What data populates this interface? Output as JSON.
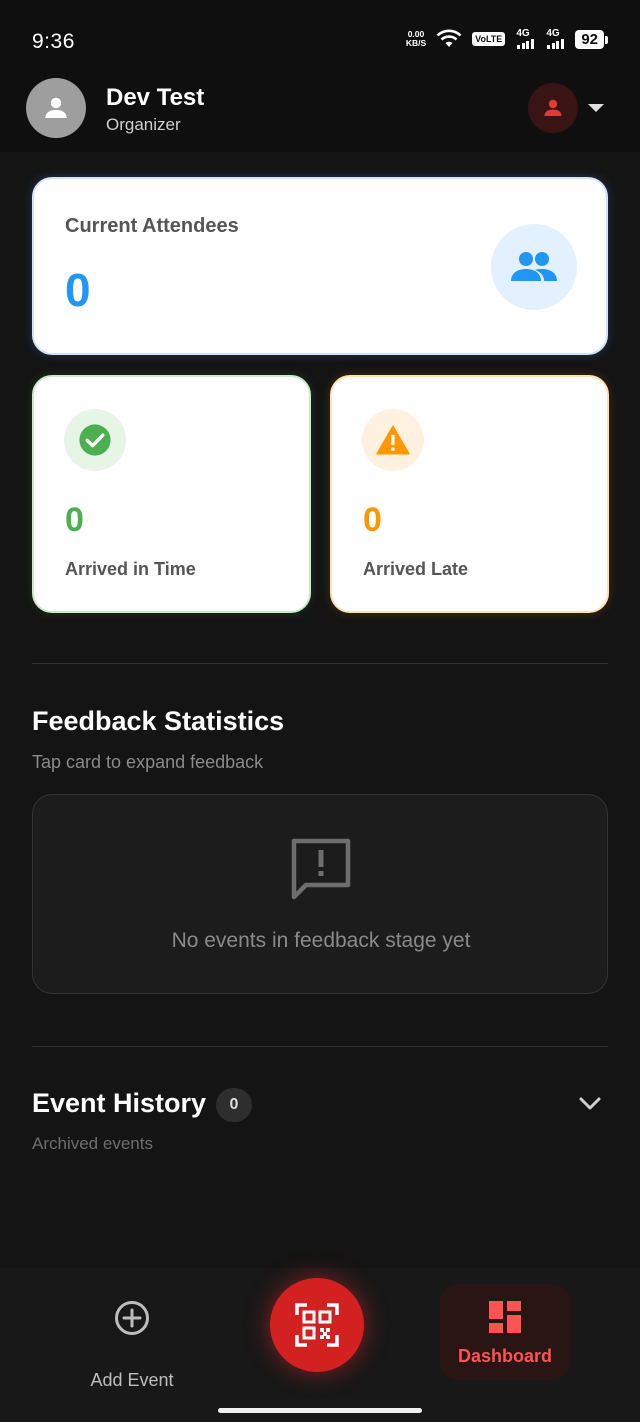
{
  "status_bar": {
    "time": "9:36",
    "net_speed_value": "0.00",
    "net_speed_unit": "KB/S",
    "volte": "VoLTE",
    "sim1": "4G",
    "sim2": "4G",
    "battery": "92"
  },
  "header": {
    "user_name": "Dev Test",
    "user_role": "Organizer"
  },
  "stats": {
    "current_attendees_label": "Current Attendees",
    "current_attendees_value": "0",
    "arrived_in_time_value": "0",
    "arrived_in_time_label": "Arrived in Time",
    "arrived_late_value": "0",
    "arrived_late_label": "Arrived Late"
  },
  "feedback": {
    "title": "Feedback Statistics",
    "subtitle": "Tap card to expand feedback",
    "empty_message": "No events in feedback stage yet"
  },
  "history": {
    "title": "Event History",
    "count": "0",
    "subtitle": "Archived events"
  },
  "bottom_nav": {
    "add_event_label": "Add Event",
    "dashboard_label": "Dashboard"
  },
  "colors": {
    "accent_red": "#d32020",
    "blue": "#2196f3",
    "green": "#4caf50",
    "orange": "#ff9800"
  }
}
